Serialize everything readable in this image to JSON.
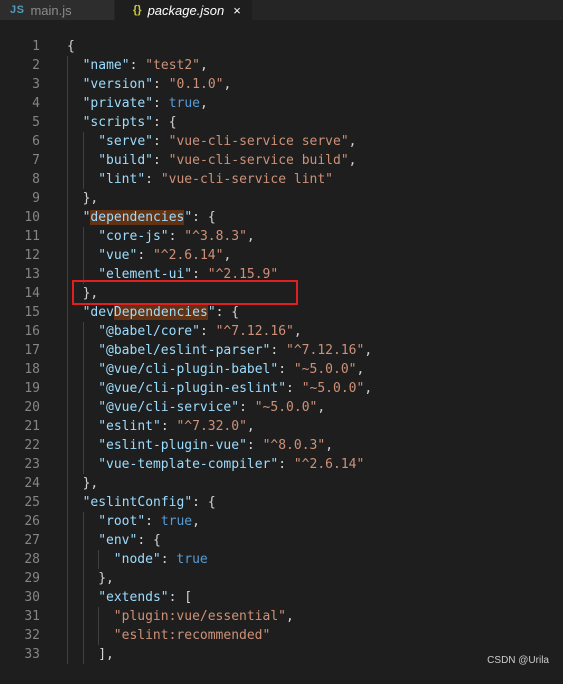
{
  "tabs": [
    {
      "badge": "JS",
      "label": "main.js",
      "active": false
    },
    {
      "badge": "{}",
      "label": "package.json",
      "active": true,
      "close": "×"
    }
  ],
  "lines": [
    {
      "n": "1",
      "indent": 0,
      "tokens": [
        [
          "{",
          "p"
        ]
      ]
    },
    {
      "n": "2",
      "indent": 1,
      "tokens": [
        [
          "\"name\"",
          "k"
        ],
        [
          ": ",
          "p"
        ],
        [
          "\"test2\"",
          "s"
        ],
        [
          ",",
          "p"
        ]
      ]
    },
    {
      "n": "3",
      "indent": 1,
      "tokens": [
        [
          "\"version\"",
          "k"
        ],
        [
          ": ",
          "p"
        ],
        [
          "\"0.1.0\"",
          "s"
        ],
        [
          ",",
          "p"
        ]
      ]
    },
    {
      "n": "4",
      "indent": 1,
      "tokens": [
        [
          "\"private\"",
          "k"
        ],
        [
          ": ",
          "p"
        ],
        [
          "true",
          "b"
        ],
        [
          ",",
          "p"
        ]
      ]
    },
    {
      "n": "5",
      "indent": 1,
      "tokens": [
        [
          "\"scripts\"",
          "k"
        ],
        [
          ": {",
          "p"
        ]
      ]
    },
    {
      "n": "6",
      "indent": 2,
      "tokens": [
        [
          "\"serve\"",
          "k"
        ],
        [
          ": ",
          "p"
        ],
        [
          "\"vue-cli-service serve\"",
          "s"
        ],
        [
          ",",
          "p"
        ]
      ]
    },
    {
      "n": "7",
      "indent": 2,
      "tokens": [
        [
          "\"build\"",
          "k"
        ],
        [
          ": ",
          "p"
        ],
        [
          "\"vue-cli-service build\"",
          "s"
        ],
        [
          ",",
          "p"
        ]
      ]
    },
    {
      "n": "8",
      "indent": 2,
      "tokens": [
        [
          "\"lint\"",
          "k"
        ],
        [
          ": ",
          "p"
        ],
        [
          "\"vue-cli-service lint\"",
          "s"
        ]
      ]
    },
    {
      "n": "9",
      "indent": 1,
      "tokens": [
        [
          "},",
          "p"
        ]
      ]
    },
    {
      "n": "10",
      "indent": 1,
      "tokens": [
        [
          "\"",
          "k"
        ],
        [
          "dependencies",
          "k hl"
        ],
        [
          "\"",
          "k"
        ],
        [
          ": {",
          "p"
        ]
      ]
    },
    {
      "n": "11",
      "indent": 2,
      "tokens": [
        [
          "\"core-js\"",
          "k"
        ],
        [
          ": ",
          "p"
        ],
        [
          "\"^3.8.3\"",
          "s"
        ],
        [
          ",",
          "p"
        ]
      ]
    },
    {
      "n": "12",
      "indent": 2,
      "tokens": [
        [
          "\"vue\"",
          "k"
        ],
        [
          ": ",
          "p"
        ],
        [
          "\"^2.6.14\"",
          "s"
        ],
        [
          ",",
          "p"
        ]
      ]
    },
    {
      "n": "13",
      "indent": 2,
      "tokens": [
        [
          "\"element-ui\"",
          "k"
        ],
        [
          ": ",
          "p"
        ],
        [
          "\"^2.15.9\"",
          "s"
        ]
      ]
    },
    {
      "n": "14",
      "indent": 1,
      "tokens": [
        [
          "},",
          "p"
        ]
      ]
    },
    {
      "n": "15",
      "indent": 1,
      "tokens": [
        [
          "\"dev",
          "k"
        ],
        [
          "Dependencies",
          "k hl"
        ],
        [
          "\"",
          "k"
        ],
        [
          ": {",
          "p"
        ]
      ]
    },
    {
      "n": "16",
      "indent": 2,
      "tokens": [
        [
          "\"@babel/core\"",
          "k"
        ],
        [
          ": ",
          "p"
        ],
        [
          "\"^7.12.16\"",
          "s"
        ],
        [
          ",",
          "p"
        ]
      ]
    },
    {
      "n": "17",
      "indent": 2,
      "tokens": [
        [
          "\"@babel/eslint-parser\"",
          "k"
        ],
        [
          ": ",
          "p"
        ],
        [
          "\"^7.12.16\"",
          "s"
        ],
        [
          ",",
          "p"
        ]
      ]
    },
    {
      "n": "18",
      "indent": 2,
      "tokens": [
        [
          "\"@vue/cli-plugin-babel\"",
          "k"
        ],
        [
          ": ",
          "p"
        ],
        [
          "\"~5.0.0\"",
          "s"
        ],
        [
          ",",
          "p"
        ]
      ]
    },
    {
      "n": "19",
      "indent": 2,
      "tokens": [
        [
          "\"@vue/cli-plugin-eslint\"",
          "k"
        ],
        [
          ": ",
          "p"
        ],
        [
          "\"~5.0.0\"",
          "s"
        ],
        [
          ",",
          "p"
        ]
      ]
    },
    {
      "n": "20",
      "indent": 2,
      "tokens": [
        [
          "\"@vue/cli-service\"",
          "k"
        ],
        [
          ": ",
          "p"
        ],
        [
          "\"~5.0.0\"",
          "s"
        ],
        [
          ",",
          "p"
        ]
      ]
    },
    {
      "n": "21",
      "indent": 2,
      "tokens": [
        [
          "\"eslint\"",
          "k"
        ],
        [
          ": ",
          "p"
        ],
        [
          "\"^7.32.0\"",
          "s"
        ],
        [
          ",",
          "p"
        ]
      ]
    },
    {
      "n": "22",
      "indent": 2,
      "tokens": [
        [
          "\"eslint-plugin-vue\"",
          "k"
        ],
        [
          ": ",
          "p"
        ],
        [
          "\"^8.0.3\"",
          "s"
        ],
        [
          ",",
          "p"
        ]
      ]
    },
    {
      "n": "23",
      "indent": 2,
      "tokens": [
        [
          "\"vue-template-compiler\"",
          "k"
        ],
        [
          ": ",
          "p"
        ],
        [
          "\"^2.6.14\"",
          "s"
        ]
      ]
    },
    {
      "n": "24",
      "indent": 1,
      "tokens": [
        [
          "},",
          "p"
        ]
      ]
    },
    {
      "n": "25",
      "indent": 1,
      "tokens": [
        [
          "\"eslintConfig\"",
          "k"
        ],
        [
          ": {",
          "p"
        ]
      ]
    },
    {
      "n": "26",
      "indent": 2,
      "tokens": [
        [
          "\"root\"",
          "k"
        ],
        [
          ": ",
          "p"
        ],
        [
          "true",
          "b"
        ],
        [
          ",",
          "p"
        ]
      ]
    },
    {
      "n": "27",
      "indent": 2,
      "tokens": [
        [
          "\"env\"",
          "k"
        ],
        [
          ": {",
          "p"
        ]
      ]
    },
    {
      "n": "28",
      "indent": 3,
      "tokens": [
        [
          "\"node\"",
          "k"
        ],
        [
          ": ",
          "p"
        ],
        [
          "true",
          "b"
        ]
      ]
    },
    {
      "n": "29",
      "indent": 2,
      "tokens": [
        [
          "},",
          "p"
        ]
      ]
    },
    {
      "n": "30",
      "indent": 2,
      "tokens": [
        [
          "\"extends\"",
          "k"
        ],
        [
          ": [",
          "p"
        ]
      ]
    },
    {
      "n": "31",
      "indent": 3,
      "tokens": [
        [
          "\"plugin:vue/essential\"",
          "s"
        ],
        [
          ",",
          "p"
        ]
      ]
    },
    {
      "n": "32",
      "indent": 3,
      "tokens": [
        [
          "\"eslint:recommended\"",
          "s"
        ]
      ]
    },
    {
      "n": "33",
      "indent": 2,
      "tokens": [
        [
          "],",
          "p"
        ]
      ]
    }
  ],
  "watermark": "CSDN @Urila",
  "colors": {
    "key": "#9cdcfe",
    "string": "#ce9178",
    "bool": "#569cd6",
    "highlight": "#613214",
    "annotation": "#e02020"
  }
}
